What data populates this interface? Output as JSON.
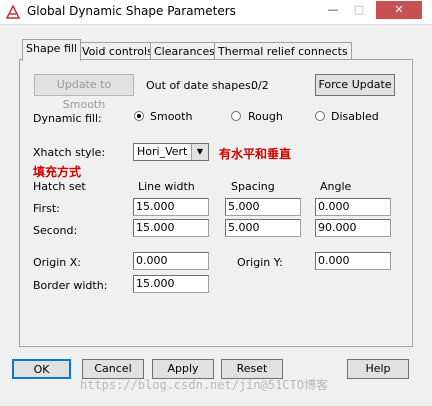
{
  "window": {
    "title": "Global Dynamic Shape Parameters",
    "min_label": "—",
    "max_label": "□",
    "close_label": "✕"
  },
  "tabs": [
    "Shape fill",
    "Void controls",
    "Clearances",
    "Thermal relief connects"
  ],
  "update": {
    "update_button": "Update to Smooth",
    "out_of_date_label": "Out of date shapes:",
    "out_of_date_value": "0/2",
    "force_button": "Force Update"
  },
  "dynamic_fill": {
    "label": "Dynamic fill:",
    "options": [
      "Smooth",
      "Rough",
      "Disabled"
    ],
    "selected": "Smooth"
  },
  "xhatch": {
    "label": "Xhatch style:",
    "value": "Hori_Vert",
    "annotation": "有水平和垂直",
    "annotation2": "填充方式"
  },
  "hatch": {
    "headers": {
      "set": "Hatch set",
      "line_width": "Line width",
      "spacing": "Spacing",
      "angle": "Angle"
    },
    "first": {
      "label": "First:",
      "line_width": "15.000",
      "spacing": "5.000",
      "angle": "0.000"
    },
    "second": {
      "label": "Second:",
      "line_width": "15.000",
      "spacing": "5.000",
      "angle": "90.000"
    }
  },
  "origin": {
    "x_label": "Origin X:",
    "x_value": "0.000",
    "y_label": "Origin Y:",
    "y_value": "0.000"
  },
  "border": {
    "label": "Border width:",
    "value": "15.000"
  },
  "buttons": {
    "ok": "OK",
    "cancel": "Cancel",
    "apply": "Apply",
    "reset": "Reset",
    "help": "Help"
  },
  "watermark": "https://blog.csdn.net/jin@51CTO博客"
}
